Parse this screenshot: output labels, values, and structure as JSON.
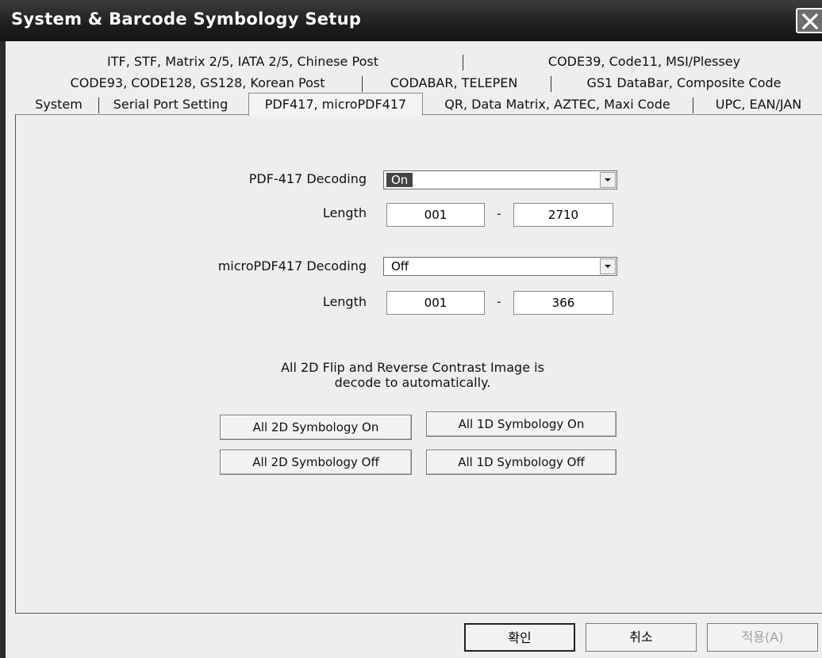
{
  "window": {
    "title": "System & Barcode Symbology Setup"
  },
  "tabs": {
    "row1": [
      "ITF, STF, Matrix 2/5, IATA 2/5, Chinese Post",
      "CODE39, Code11, MSI/Plessey"
    ],
    "row2": [
      "CODE93, CODE128, GS128, Korean Post",
      "CODABAR, TELEPEN",
      "GS1 DataBar, Composite Code"
    ],
    "row3": [
      "System",
      "Serial Port Setting",
      "PDF417, microPDF417",
      "QR, Data Matrix, AZTEC, Maxi Code",
      "UPC, EAN/JAN"
    ],
    "active": "PDF417, microPDF417"
  },
  "pdf417": {
    "decoding_label": "PDF-417 Decoding",
    "decoding_value": "On",
    "length_label": "Length",
    "length_min": "001",
    "length_separator": "-",
    "length_max": "2710"
  },
  "micropdf417": {
    "decoding_label": "microPDF417 Decoding",
    "decoding_value": "Off",
    "length_label": "Length",
    "length_min": "001",
    "length_separator": "-",
    "length_max": "366"
  },
  "note": {
    "line1": "All 2D Flip and Reverse Contrast Image is",
    "line2": "decode to automatically."
  },
  "buttons": {
    "all_2d_on": "All 2D Symbology On",
    "all_1d_on": "All 1D Symbology On",
    "all_2d_off": "All 2D Symbology Off",
    "all_1d_off": "All 1D Symbology Off"
  },
  "dialog_buttons": {
    "ok": "확인",
    "cancel": "취소",
    "apply": "적용(A)"
  },
  "icons": {
    "close": "close-icon",
    "dropdown": "dropdown-arrow-icon"
  }
}
